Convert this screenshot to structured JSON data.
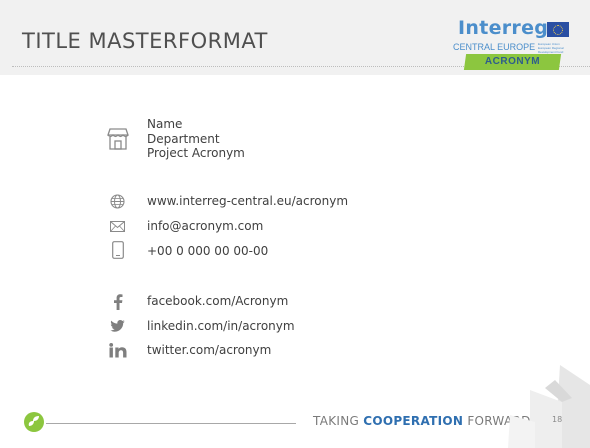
{
  "title": "TITLE MASTERFORMAT",
  "logo": {
    "wordmark": "Interreg",
    "subtitle": "CENTRAL EUROPE",
    "tiny_text": "European Union European Regional Development Fund",
    "badge": "ACRONYM",
    "colors": {
      "blue": "#4b8ecb",
      "green": "#8cc63f",
      "flag": "#2a4fa3"
    }
  },
  "contact": {
    "name": "Name",
    "department": "Department",
    "project": "Project Acronym",
    "icon": "store-icon"
  },
  "links": [
    {
      "icon": "globe-icon",
      "text": "www.interreg-central.eu/acronym"
    },
    {
      "icon": "mail-icon",
      "text": "info@acronym.com"
    },
    {
      "icon": "phone-icon",
      "text": "+00 0 000 00 00-00"
    }
  ],
  "social": [
    {
      "icon": "facebook-icon",
      "text": "facebook.com/Acronym"
    },
    {
      "icon": "twitter-icon",
      "text": "linkedin.com/in/acronym"
    },
    {
      "icon": "linkedin-icon",
      "text": "twitter.com/acronym"
    }
  ],
  "footer": {
    "prefix": "TAKING ",
    "highlight": "COOPERATION",
    "suffix": " FORWARD",
    "page": "18"
  }
}
